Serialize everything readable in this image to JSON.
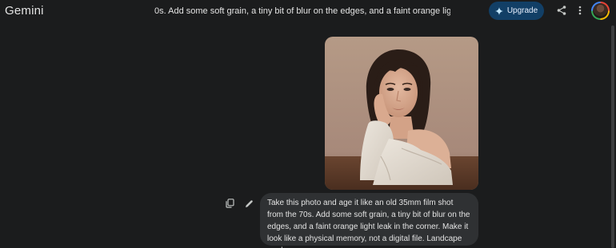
{
  "header": {
    "brand": "Gemini",
    "conversation_title": "0s. Add some soft grain, a tiny bit of blur on the edges, and a faint orange light leak in",
    "upgrade_label": "Upgrade"
  },
  "icons": {
    "upgrade": "sparkle-icon",
    "share": "share-icon",
    "menu": "more-vert-icon",
    "copy": "copy-icon",
    "edit": "edit-pencil-icon"
  },
  "message": {
    "text": "Take this photo and age it like an old 35mm film shot from the 70s. Add some soft grain, a tiny bit of blur on the edges, and a faint orange light leak in the corner. Make it look like a physical memory, not a digital file. Landcape mode"
  },
  "colors": {
    "background": "#1b1c1d",
    "bubble": "#2f3133",
    "upgrade_button": "#123f66",
    "text": "#e3e3e3"
  }
}
